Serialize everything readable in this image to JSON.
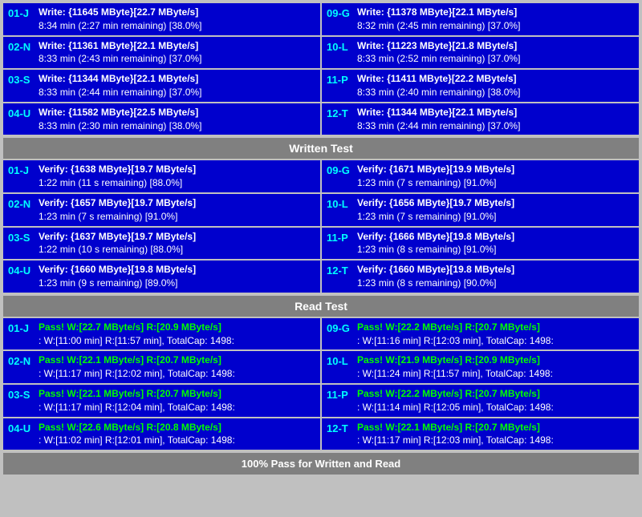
{
  "sections": {
    "write_test": {
      "label": "Written Test",
      "rows": [
        {
          "left": {
            "id": "01-J",
            "line1": "Write: {11645 MByte}[22.7 MByte/s]",
            "line2": "8:34 min (2:27 min remaining)  [38.0%]"
          },
          "right": {
            "id": "09-G",
            "line1": "Write: {11378 MByte}[22.1 MByte/s]",
            "line2": "8:32 min (2:45 min remaining)  [37.0%]"
          }
        },
        {
          "left": {
            "id": "02-N",
            "line1": "Write: {11361 MByte}[22.1 MByte/s]",
            "line2": "8:33 min (2:43 min remaining)  [37.0%]"
          },
          "right": {
            "id": "10-L",
            "line1": "Write: {11223 MByte}[21.8 MByte/s]",
            "line2": "8:33 min (2:52 min remaining)  [37.0%]"
          }
        },
        {
          "left": {
            "id": "03-S",
            "line1": "Write: {11344 MByte}[22.1 MByte/s]",
            "line2": "8:33 min (2:44 min remaining)  [37.0%]"
          },
          "right": {
            "id": "11-P",
            "line1": "Write: {11411 MByte}[22.2 MByte/s]",
            "line2": "8:33 min (2:40 min remaining)  [38.0%]"
          }
        },
        {
          "left": {
            "id": "04-U",
            "line1": "Write: {11582 MByte}[22.5 MByte/s]",
            "line2": "8:33 min (2:30 min remaining)  [38.0%]"
          },
          "right": {
            "id": "12-T",
            "line1": "Write: {11344 MByte}[22.1 MByte/s]",
            "line2": "8:33 min (2:44 min remaining)  [37.0%]"
          }
        }
      ]
    },
    "verify_test": {
      "rows": [
        {
          "left": {
            "id": "01-J",
            "line1": "Verify: {1638 MByte}[19.7 MByte/s]",
            "line2": "1:22 min (11 s remaining)  [88.0%]"
          },
          "right": {
            "id": "09-G",
            "line1": "Verify: {1671 MByte}[19.9 MByte/s]",
            "line2": "1:23 min (7 s remaining)   [91.0%]"
          }
        },
        {
          "left": {
            "id": "02-N",
            "line1": "Verify: {1657 MByte}[19.7 MByte/s]",
            "line2": "1:23 min (7 s remaining)   [91.0%]"
          },
          "right": {
            "id": "10-L",
            "line1": "Verify: {1656 MByte}[19.7 MByte/s]",
            "line2": "1:23 min (7 s remaining)   [91.0%]"
          }
        },
        {
          "left": {
            "id": "03-S",
            "line1": "Verify: {1637 MByte}[19.7 MByte/s]",
            "line2": "1:22 min (10 s remaining)  [88.0%]"
          },
          "right": {
            "id": "11-P",
            "line1": "Verify: {1666 MByte}[19.8 MByte/s]",
            "line2": "1:23 min (8 s remaining)   [91.0%]"
          }
        },
        {
          "left": {
            "id": "04-U",
            "line1": "Verify: {1660 MByte}[19.8 MByte/s]",
            "line2": "1:23 min (9 s remaining)   [89.0%]"
          },
          "right": {
            "id": "12-T",
            "line1": "Verify: {1660 MByte}[19.8 MByte/s]",
            "line2": "1:23 min (8 s remaining)   [90.0%]"
          }
        }
      ]
    },
    "read_test": {
      "label": "Read Test",
      "rows": [
        {
          "left": {
            "id": "01-J",
            "line1": "Pass! W:[22.7 MByte/s] R:[20.9 MByte/s]",
            "line2": ": W:[11:00 min] R:[11:57 min], TotalCap: 1498:"
          },
          "right": {
            "id": "09-G",
            "line1": "Pass! W:[22.2 MByte/s] R:[20.7 MByte/s]",
            "line2": ": W:[11:16 min] R:[12:03 min], TotalCap: 1498:"
          }
        },
        {
          "left": {
            "id": "02-N",
            "line1": "Pass! W:[22.1 MByte/s] R:[20.7 MByte/s]",
            "line2": ": W:[11:17 min] R:[12:02 min], TotalCap: 1498:"
          },
          "right": {
            "id": "10-L",
            "line1": "Pass! W:[21.9 MByte/s] R:[20.9 MByte/s]",
            "line2": ": W:[11:24 min] R:[11:57 min], TotalCap: 1498:"
          }
        },
        {
          "left": {
            "id": "03-S",
            "line1": "Pass! W:[22.1 MByte/s] R:[20.7 MByte/s]",
            "line2": ": W:[11:17 min] R:[12:04 min], TotalCap: 1498:"
          },
          "right": {
            "id": "11-P",
            "line1": "Pass! W:[22.2 MByte/s] R:[20.7 MByte/s]",
            "line2": ": W:[11:14 min] R:[12:05 min], TotalCap: 1498:"
          }
        },
        {
          "left": {
            "id": "04-U",
            "line1": "Pass! W:[22.6 MByte/s] R:[20.8 MByte/s]",
            "line2": ": W:[11:02 min] R:[12:01 min], TotalCap: 1498:"
          },
          "right": {
            "id": "12-T",
            "line1": "Pass! W:[22.1 MByte/s] R:[20.7 MByte/s]",
            "line2": ": W:[11:17 min] R:[12:03 min], TotalCap: 1498:"
          }
        }
      ]
    }
  },
  "headers": {
    "write": "Written Test",
    "read": "Read Test"
  },
  "footer": "100% Pass for Written and Read"
}
